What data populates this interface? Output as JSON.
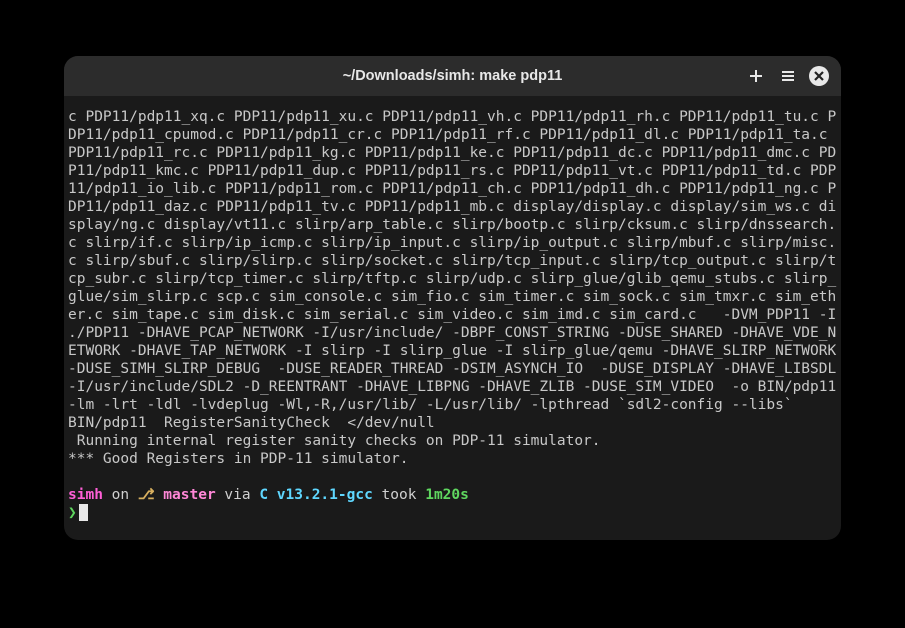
{
  "window": {
    "title": "~/Downloads/simh: make pdp11"
  },
  "output": {
    "compile_text": "c PDP11/pdp11_xq.c PDP11/pdp11_xu.c PDP11/pdp11_vh.c PDP11/pdp11_rh.c PDP11/pdp11_tu.c PDP11/pdp11_cpumod.c PDP11/pdp11_cr.c PDP11/pdp11_rf.c PDP11/pdp11_dl.c PDP11/pdp11_ta.c PDP11/pdp11_rc.c PDP11/pdp11_kg.c PDP11/pdp11_ke.c PDP11/pdp11_dc.c PDP11/pdp11_dmc.c PDP11/pdp11_kmc.c PDP11/pdp11_dup.c PDP11/pdp11_rs.c PDP11/pdp11_vt.c PDP11/pdp11_td.c PDP11/pdp11_io_lib.c PDP11/pdp11_rom.c PDP11/pdp11_ch.c PDP11/pdp11_dh.c PDP11/pdp11_ng.c PDP11/pdp11_daz.c PDP11/pdp11_tv.c PDP11/pdp11_mb.c display/display.c display/sim_ws.c display/ng.c display/vt11.c slirp/arp_table.c slirp/bootp.c slirp/cksum.c slirp/dnssearch.c slirp/if.c slirp/ip_icmp.c slirp/ip_input.c slirp/ip_output.c slirp/mbuf.c slirp/misc.c slirp/sbuf.c slirp/slirp.c slirp/socket.c slirp/tcp_input.c slirp/tcp_output.c slirp/tcp_subr.c slirp/tcp_timer.c slirp/tftp.c slirp/udp.c slirp_glue/glib_qemu_stubs.c slirp_glue/sim_slirp.c scp.c sim_console.c sim_fio.c sim_timer.c sim_sock.c sim_tmxr.c sim_ether.c sim_tape.c sim_disk.c sim_serial.c sim_video.c sim_imd.c sim_card.c   -DVM_PDP11 -I ./PDP11 -DHAVE_PCAP_NETWORK -I/usr/include/ -DBPF_CONST_STRING -DUSE_SHARED -DHAVE_VDE_NETWORK -DHAVE_TAP_NETWORK -I slirp -I slirp_glue -I slirp_glue/qemu -DHAVE_SLIRP_NETWORK -DUSE_SIMH_SLIRP_DEBUG  -DUSE_READER_THREAD -DSIM_ASYNCH_IO  -DUSE_DISPLAY -DHAVE_LIBSDL -I/usr/include/SDL2 -D_REENTRANT -DHAVE_LIBPNG -DHAVE_ZLIB -DUSE_SIM_VIDEO  -o BIN/pdp11 -lm -lrt -ldl -lvdeplug -Wl,-R,/usr/lib/ -L/usr/lib/ -lpthread `sdl2-config --libs`\nBIN/pdp11  RegisterSanityCheck  </dev/null\n Running internal register sanity checks on PDP-11 simulator.\n*** Good Registers in PDP-11 simulator."
  },
  "prompt": {
    "dir": "simh",
    "on": " on ",
    "branch_icon": "⎇",
    "branch": " master",
    "via": " via ",
    "compiler": "C v13.2.1-gcc",
    "took": " took ",
    "duration": "1m20s",
    "symbol": "❯"
  }
}
